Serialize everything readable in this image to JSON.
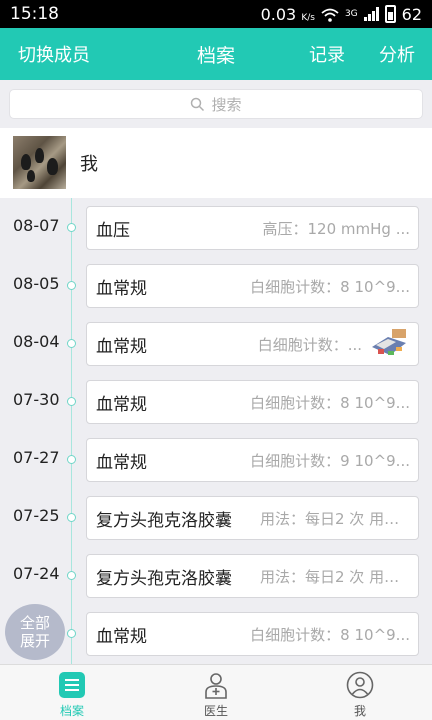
{
  "status_bar": {
    "time": "15:18",
    "speed": "0.03",
    "speed_unit": "K/s",
    "network": "3G",
    "battery": "62"
  },
  "app_bar": {
    "switch_member": "切换成员",
    "title": "档案",
    "record": "记录",
    "analysis": "分析"
  },
  "search": {
    "placeholder": "搜索"
  },
  "member": {
    "name": "我"
  },
  "entries": [
    {
      "date": "08-07",
      "name": "血压",
      "detail": "高压：120 mmHg ..."
    },
    {
      "date": "08-05",
      "name": "血常规",
      "detail": "白细胞计数：8 10^9..."
    },
    {
      "date": "08-04",
      "name": "血常规",
      "detail": "白细胞计数：..."
    },
    {
      "date": "07-30",
      "name": "血常规",
      "detail": "白细胞计数：8 10^9..."
    },
    {
      "date": "07-27",
      "name": "血常规",
      "detail": "白细胞计数：9 10^9..."
    },
    {
      "date": "07-25",
      "name": "复方头孢克洛胶囊",
      "detail": "用法：每日2 次 用量..."
    },
    {
      "date": "07-24",
      "name": "复方头孢克洛胶囊",
      "detail": "用法：每日2 次 用量..."
    },
    {
      "date": "",
      "name": "血常规",
      "detail": "白细胞计数：8 10^9..."
    }
  ],
  "fab": {
    "line1": "全部",
    "line2": "展开"
  },
  "bottom_nav": {
    "records": "档案",
    "doctor": "医生",
    "me": "我"
  },
  "colors": {
    "accent": "#22c9b4",
    "timeline": "#a8e6de"
  }
}
